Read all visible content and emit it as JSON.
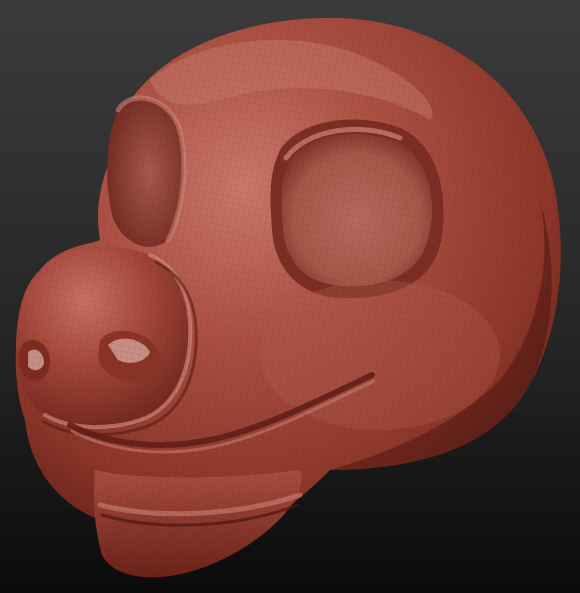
{
  "scene": {
    "subject": "sculpted-creature-head",
    "material_color": "#a5463a",
    "material_highlight": "#c87a6b",
    "material_shadow": "#5e1f18",
    "background_top": "#3a3a3a",
    "background_bottom": "#0c0c0c",
    "wireframe_visible": true
  }
}
